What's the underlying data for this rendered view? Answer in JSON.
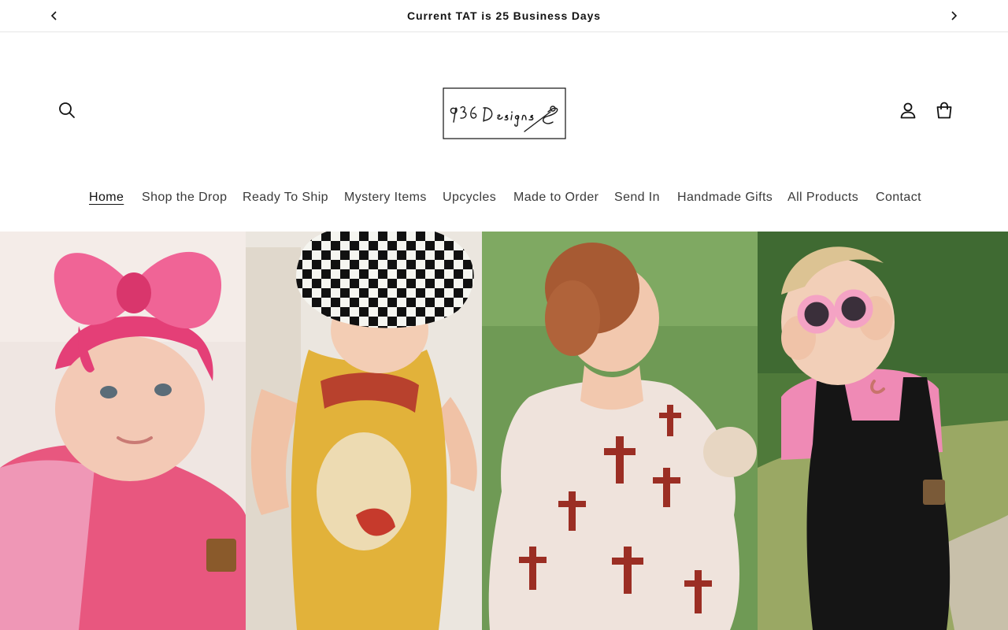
{
  "announcement": {
    "message": "Current TAT is 25 Business Days",
    "prev_icon": "chevron-left-icon",
    "next_icon": "chevron-right-icon"
  },
  "header": {
    "logo_text": "936 Designs",
    "icons": {
      "search": "search-icon",
      "account": "account-icon",
      "cart": "cart-icon"
    }
  },
  "nav": {
    "items": [
      {
        "label": "Home",
        "active": true
      },
      {
        "label": "Shop the Drop"
      },
      {
        "label": "Ready To Ship"
      },
      {
        "label": "Mystery Items"
      },
      {
        "label": "Upcycles"
      },
      {
        "label": "Made to Order"
      },
      {
        "label": "Send In"
      },
      {
        "label": "Handmade Gifts"
      },
      {
        "label": "All Products"
      },
      {
        "label": "Contact"
      }
    ]
  },
  "hero": {
    "panels": [
      {
        "subject": "baby-in-pink-bow-photo",
        "accent": "#e8577f"
      },
      {
        "subject": "toddler-in-checkered-headwrap-photo",
        "accent": "#e2b23a"
      },
      {
        "subject": "toddler-in-cross-print-dress-photo",
        "accent": "#6f9a55"
      },
      {
        "subject": "toddler-in-overalls-and-pink-glasses-photo",
        "accent": "#1f1f1f"
      }
    ]
  },
  "colors": {
    "text": "#121212",
    "border": "#e6e6e6",
    "background": "#ffffff"
  }
}
